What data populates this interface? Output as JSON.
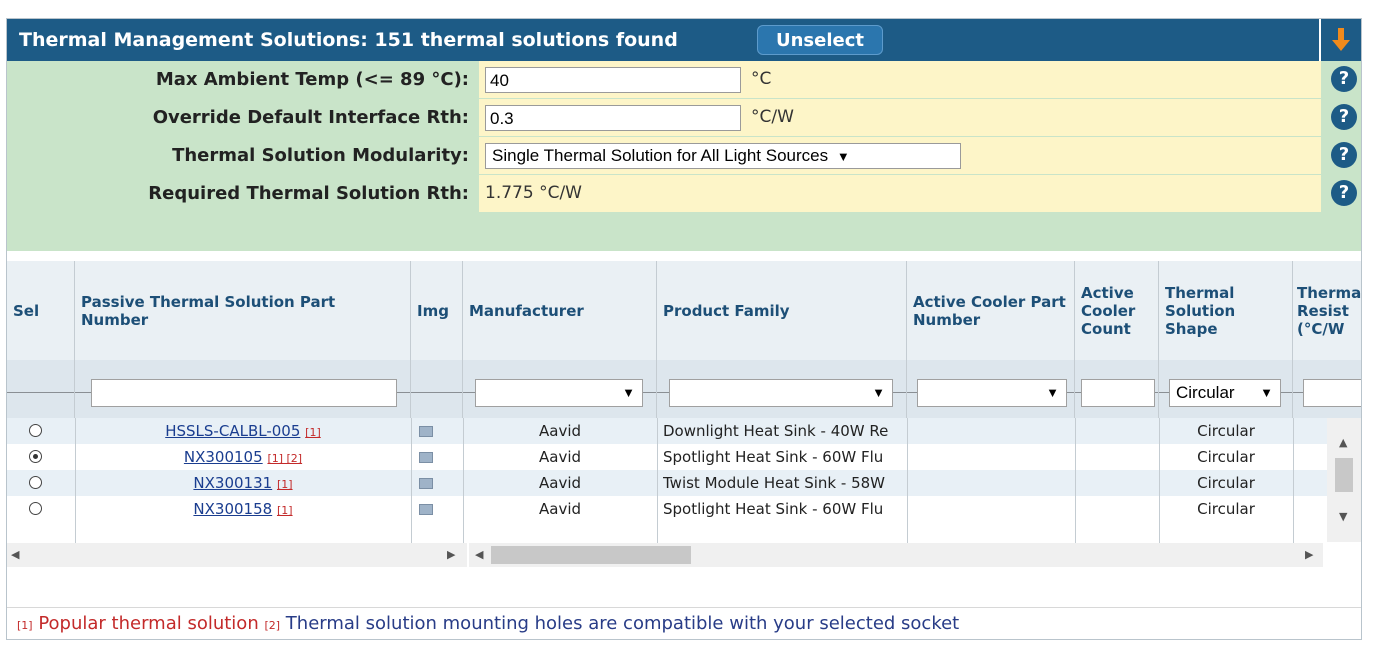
{
  "header": {
    "title": "Thermal Management Solutions: 151 thermal solutions found",
    "unselect_label": "Unselect"
  },
  "params": {
    "max_ambient": {
      "label": "Max Ambient Temp (<= 89 °C):",
      "value": "40",
      "unit": "°C"
    },
    "override_rth": {
      "label": "Override Default Interface Rth:",
      "value": "0.3",
      "unit": "°C/W"
    },
    "modularity": {
      "label": "Thermal Solution Modularity:",
      "selected": "Single Thermal Solution for All Light Sources",
      "arrow": "▼"
    },
    "required_rth": {
      "label": "Required Thermal Solution Rth:",
      "value": "1.775 °C/W"
    },
    "help_glyph": "?"
  },
  "table": {
    "columns": {
      "sel": "Sel",
      "part": "Passive Thermal Solution Part Number",
      "img": "Img",
      "manufacturer": "Manufacturer",
      "family": "Product Family",
      "active_part": "Active Cooler Part Number",
      "active_count": "Active Cooler Count",
      "shape": "Thermal Solution Shape",
      "resist": "Thermal Resist (°C/W"
    },
    "filters": {
      "shape_selected": "Circular",
      "arrow": "▼"
    },
    "rows": [
      {
        "selected": false,
        "part": "HSSLS-CALBL-005",
        "notes": "[1]",
        "manufacturer": "Aavid",
        "family": "Downlight Heat Sink - 40W Re",
        "shape": "Circular"
      },
      {
        "selected": true,
        "part": "NX300105",
        "notes": "[1] [2]",
        "manufacturer": "Aavid",
        "family": "Spotlight Heat Sink - 60W Flu",
        "shape": "Circular"
      },
      {
        "selected": false,
        "part": "NX300131",
        "notes": "[1]",
        "manufacturer": "Aavid",
        "family": "Twist Module Heat Sink - 58W",
        "shape": "Circular"
      },
      {
        "selected": false,
        "part": "NX300158",
        "notes": "[1]",
        "manufacturer": "Aavid",
        "family": "Spotlight Heat Sink - 60W Flu",
        "shape": "Circular"
      }
    ]
  },
  "footnote": {
    "mark1": "[1]",
    "text1": "Popular thermal solution",
    "mark2": "[2]",
    "text2": "Thermal solution mounting holes are compatible with your selected socket"
  },
  "colors": {
    "header_bg": "#1d5b86",
    "params_bg": "#c9e4c9",
    "value_bg": "#fdf5c8",
    "accent_arrow": "#f08a1c",
    "footnote_red": "#c32a2a",
    "footnote_blue": "#283c87"
  },
  "icons": {
    "collapse": "down-arrow-icon",
    "help": "help-icon",
    "image": "image-icon"
  }
}
